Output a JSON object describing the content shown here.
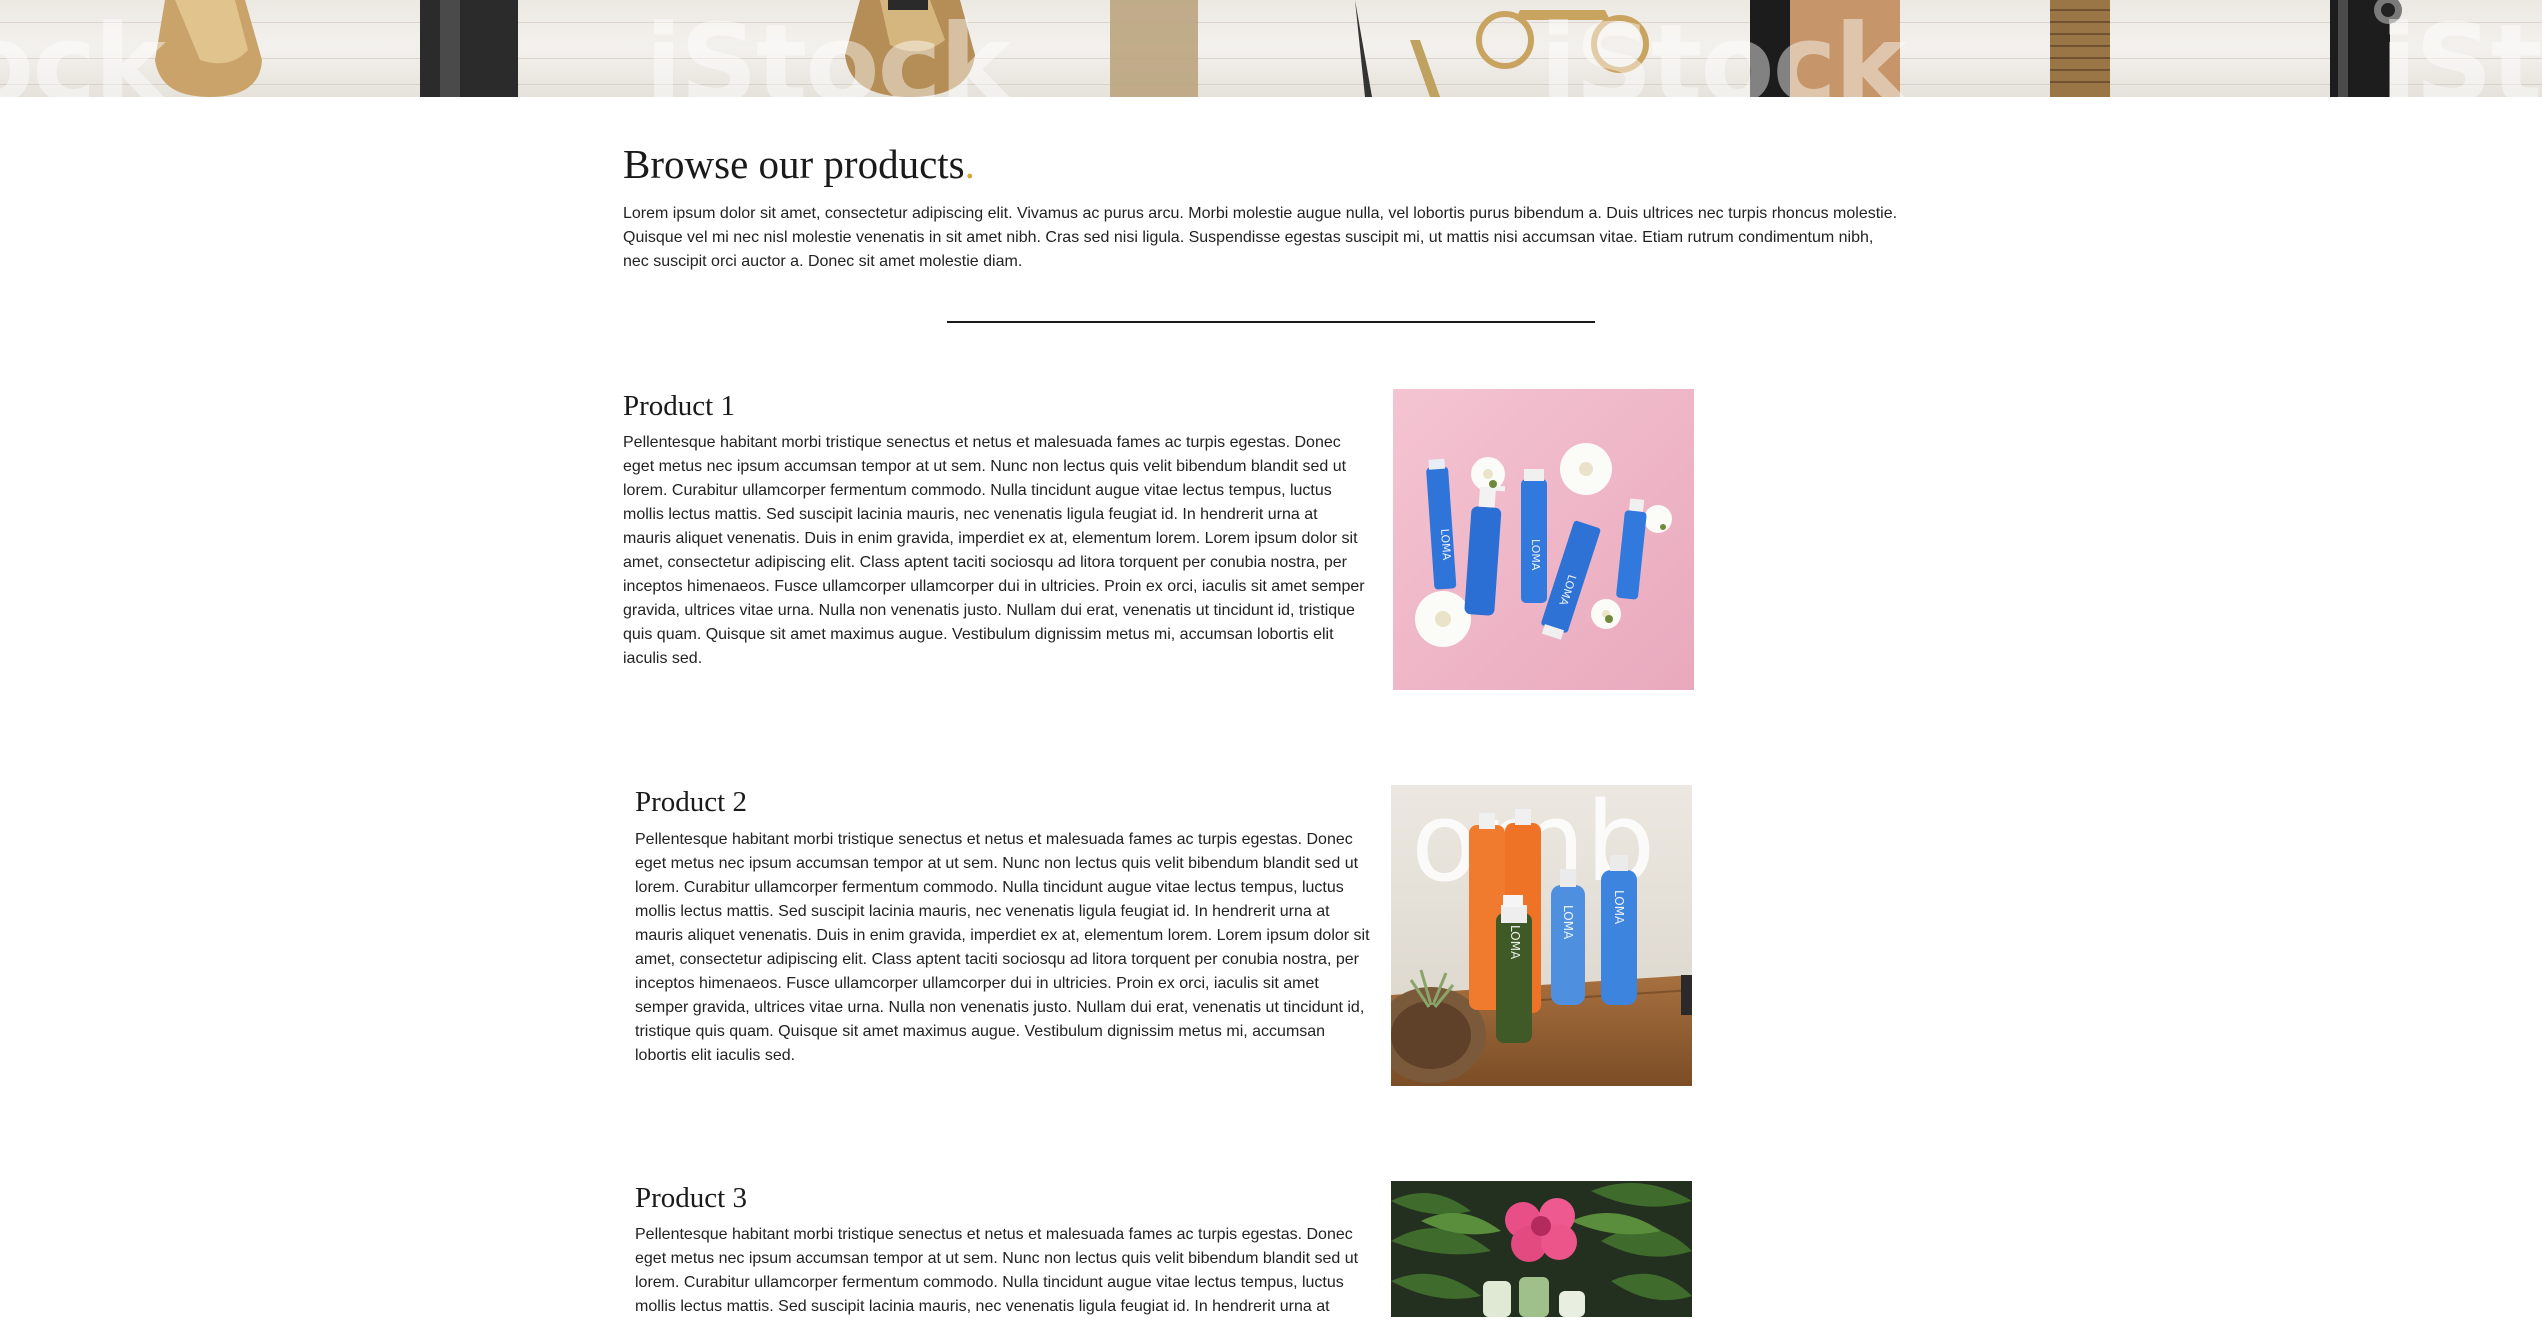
{
  "hero": {
    "watermark": "iStock",
    "watermark_left": "ock"
  },
  "main": {
    "title": "Browse our products",
    "title_dot": ".",
    "intro": "Lorem ipsum dolor sit amet, consectetur adipiscing elit. Vivamus ac purus arcu. Morbi molestie augue nulla, vel lobortis purus bibendum a. Duis ultrices nec turpis rhoncus molestie. Quisque vel mi nec nisl molestie venenatis in sit amet nibh. Cras sed nisi ligula. Suspendisse egestas suscipit mi, ut mattis nisi accumsan vitae. Etiam rutrum condimentum nibh, nec suscipit orci auctor a. Donec sit amet molestie diam."
  },
  "products": [
    {
      "title": "Product 1",
      "description": "Pellentesque habitant morbi tristique senectus et netus et malesuada fames ac turpis egestas. Donec eget metus nec ipsum accumsan tempor at ut sem. Nunc non lectus quis velit bibendum blandit sed ut lorem. Curabitur ullamcorper fermentum commodo. Nulla tincidunt augue vitae lectus tempus, luctus mollis lectus mattis. Sed suscipit lacinia mauris, nec venenatis ligula feugiat id. In hendrerit urna at mauris aliquet venenatis. Duis in enim gravida, imperdiet ex at, elementum lorem. Lorem ipsum dolor sit amet, consectetur adipiscing elit. Class aptent taciti sociosqu ad litora torquent per conubia nostra, per inceptos himenaeos. Fusce ullamcorper ullamcorper dui in ultricies. Proin ex orci, iaculis sit amet semper gravida, ultrices vitae urna. Nulla non venenatis justo. Nullam dui erat, venenatis ut tincidunt id, tristique quis quam. Quisque sit amet maximus augue. Vestibulum dignissim metus mi, accumsan lobortis elit iaculis sed.",
      "bottle_label": "LOMA"
    },
    {
      "title": "Product 2",
      "description": "Pellentesque habitant morbi tristique senectus et netus et malesuada fames ac turpis egestas. Donec eget metus nec ipsum accumsan tempor at ut sem. Nunc non lectus quis velit bibendum blandit sed ut lorem. Curabitur ullamcorper fermentum commodo. Nulla tincidunt augue vitae lectus tempus, luctus mollis lectus mattis. Sed suscipit lacinia mauris, nec venenatis ligula feugiat id. In hendrerit urna at mauris aliquet venenatis. Duis in enim gravida, imperdiet ex at, elementum lorem. Lorem ipsum dolor sit amet, consectetur adipiscing elit. Class aptent taciti sociosqu ad litora torquent per conubia nostra, per inceptos himenaeos. Fusce ullamcorper ullamcorper dui in ultricies. Proin ex orci, iaculis sit amet semper gravida, ultrices vitae urna. Nulla non venenatis justo. Nullam dui erat, venenatis ut tincidunt id, tristique quis quam. Quisque sit amet maximus augue. Vestibulum dignissim metus mi, accumsan lobortis elit iaculis sed.",
      "bottle_label": "LOMA",
      "neon_text": "omb"
    },
    {
      "title": "Product 3",
      "description": "Pellentesque habitant morbi tristique senectus et netus et malesuada fames ac turpis egestas. Donec eget metus nec ipsum accumsan tempor at ut sem. Nunc non lectus quis velit bibendum blandit sed ut lorem. Curabitur ullamcorper fermentum commodo. Nulla tincidunt augue vitae lectus tempus, luctus mollis lectus mattis. Sed suscipit lacinia mauris, nec venenatis ligula feugiat id. In hendrerit urna at"
    }
  ],
  "colors": {
    "accent_dot": "#d9a53a",
    "text": "#222222",
    "pink_bg": "#f0b6c8",
    "loma_blue": "#2f74d8"
  }
}
